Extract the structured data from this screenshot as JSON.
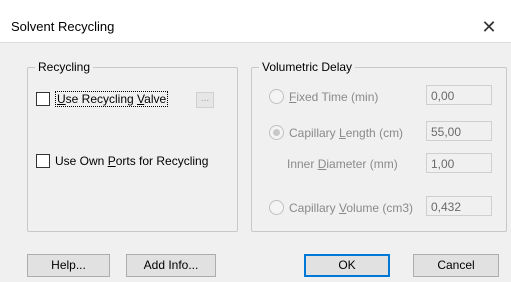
{
  "window": {
    "title": "Solvent Recycling",
    "close_glyph": "✕"
  },
  "recycling": {
    "group_label": "Recycling",
    "use_recycling_valve": {
      "pre": "",
      "u1": "U",
      "mid": "se Recycling ",
      "u2": "V",
      "post": "alve",
      "checked": false
    },
    "browse_button_label": "...",
    "use_own_ports": {
      "pre": "Use Own ",
      "u": "P",
      "post": "orts for Recycling",
      "checked": false
    }
  },
  "volumetric_delay": {
    "group_label": "Volumetric Delay",
    "fixed_time": {
      "u": "F",
      "rest": "ixed Time (min)",
      "value": "0,00",
      "selected": false
    },
    "capillary_length": {
      "pre": "Capillary ",
      "u": "L",
      "post": "ength (cm)",
      "value": "55,00",
      "selected": true
    },
    "inner_diameter": {
      "pre": "Inner ",
      "u": "D",
      "post": "iameter (mm)",
      "value": "1,00"
    },
    "capillary_volume": {
      "pre": "Capillary ",
      "u": "V",
      "post": "olume (cm3)",
      "value": "0,432",
      "selected": false
    }
  },
  "buttons": {
    "help": "Help...",
    "add_info": "Add Info...",
    "ok": "OK",
    "cancel": "Cancel"
  }
}
